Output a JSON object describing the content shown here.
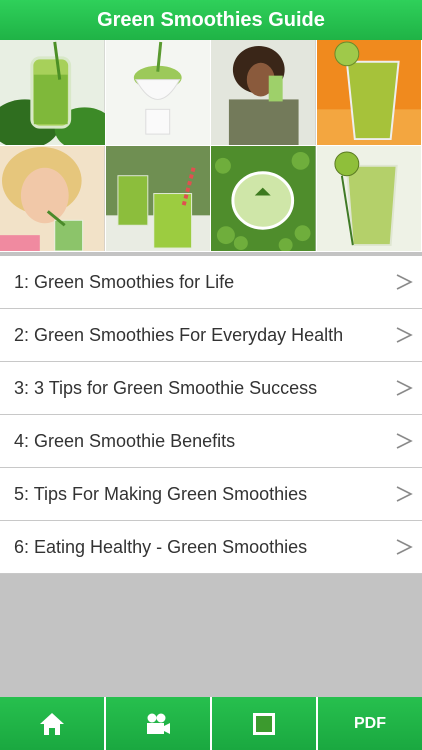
{
  "header": {
    "title": "Green Smoothies Guide"
  },
  "photos": [
    {
      "name": "photo-smoothie-jar-spinach"
    },
    {
      "name": "photo-smoothie-cup"
    },
    {
      "name": "photo-woman-drinking"
    },
    {
      "name": "photo-kiwi-smoothie-orange"
    },
    {
      "name": "photo-woman-straw"
    },
    {
      "name": "photo-glasses-straws"
    },
    {
      "name": "photo-sprouts-bowl"
    },
    {
      "name": "photo-kiwi-smoothie-glass"
    }
  ],
  "list": {
    "items": [
      {
        "label": "1: Green Smoothies for Life"
      },
      {
        "label": "2: Green Smoothies For Everyday Health"
      },
      {
        "label": "3: 3 Tips for Green Smoothie Success"
      },
      {
        "label": "4: Green Smoothie Benefits"
      },
      {
        "label": "5: Tips For Making Green Smoothies"
      },
      {
        "label": "6: Eating Healthy - Green Smoothies"
      }
    ],
    "chevron_icon": "chevron-right-icon"
  },
  "tabbar": {
    "tabs": [
      {
        "icon": "home-icon"
      },
      {
        "icon": "video-camera-icon"
      },
      {
        "icon": "gallery-icon"
      },
      {
        "label": "PDF"
      }
    ]
  },
  "colors": {
    "header": "#22c24e",
    "tab": "#1fb346",
    "background": "#c3c3c3"
  }
}
